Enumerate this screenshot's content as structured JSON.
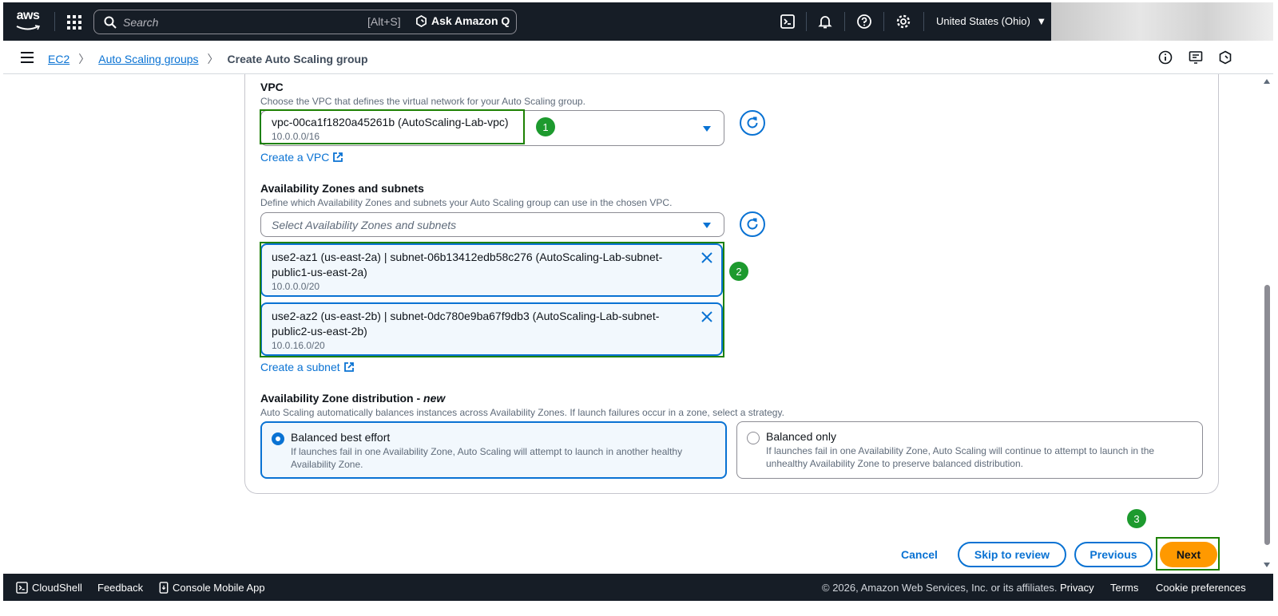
{
  "topnav": {
    "logo_text": "aws",
    "search_placeholder": "Search",
    "search_shortcut": "[Alt+S]",
    "ask_q_label": "Ask Amazon Q",
    "region_label": "United States (Ohio)",
    "icons": [
      "cloudshell-icon",
      "bell-icon",
      "help-icon",
      "settings-icon"
    ]
  },
  "breadcrumb": {
    "items": [
      "EC2",
      "Auto Scaling groups"
    ],
    "current": "Create Auto Scaling group"
  },
  "vpc": {
    "label": "VPC",
    "description": "Choose the VPC that defines the virtual network for your Auto Scaling group.",
    "selected_value": "vpc-00ca1f1820a45261b (AutoScaling-Lab-vpc)",
    "selected_cidr": "10.0.0.0/16",
    "create_link": "Create a VPC",
    "step_badge": "1"
  },
  "azs": {
    "label": "Availability Zones and subnets",
    "description": "Define which Availability Zones and subnets your Auto Scaling group can use in the chosen VPC.",
    "placeholder": "Select Availability Zones and subnets",
    "step_badge": "2",
    "tokens": [
      {
        "name": "use2-az1 (us-east-2a) | subnet-06b13412edb58c276 (AutoScaling-Lab-subnet-public1-us-east-2a)",
        "cidr": "10.0.0.0/20"
      },
      {
        "name": "use2-az2 (us-east-2b) | subnet-0dc780e9ba67f9db3 (AutoScaling-Lab-subnet-public2-us-east-2b)",
        "cidr": "10.0.16.0/20"
      }
    ],
    "create_link": "Create a subnet"
  },
  "distribution": {
    "label_prefix": "Availability Zone distribution - ",
    "label_new": "new",
    "description": "Auto Scaling automatically balances instances across Availability Zones. If launch failures occur in a zone, select a strategy.",
    "options": [
      {
        "title": "Balanced best effort",
        "desc": "If launches fail in one Availability Zone, Auto Scaling will attempt to launch in another healthy Availability Zone.",
        "selected": true
      },
      {
        "title": "Balanced only",
        "desc": "If launches fail in one Availability Zone, Auto Scaling will continue to attempt to launch in the unhealthy Availability Zone to preserve balanced distribution.",
        "selected": false
      }
    ]
  },
  "actions": {
    "cancel": "Cancel",
    "skip": "Skip to review",
    "previous": "Previous",
    "next": "Next",
    "step_badge": "3"
  },
  "footer": {
    "cloudshell": "CloudShell",
    "feedback": "Feedback",
    "mobile_app": "Console Mobile App",
    "copyright": "© 2026, Amazon Web Services, Inc. or its affiliates.",
    "privacy": "Privacy",
    "terms": "Terms",
    "cookies": "Cookie preferences"
  },
  "colors": {
    "nav_bg": "#161d26",
    "link_blue": "#0972d3",
    "highlight_green": "#1d8102",
    "primary_orange": "#ff9900"
  }
}
